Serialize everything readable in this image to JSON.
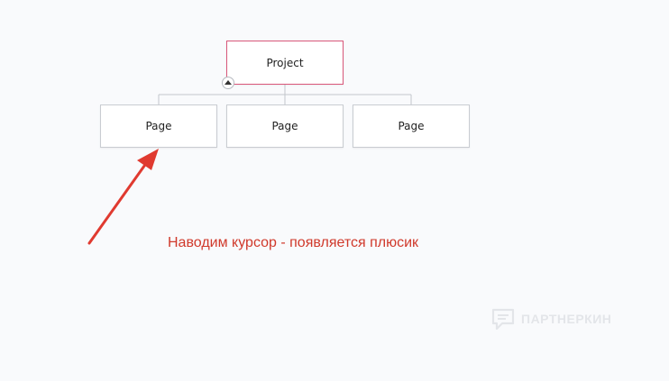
{
  "diagram": {
    "root": {
      "label": "Project"
    },
    "children": [
      {
        "label": "Page"
      },
      {
        "label": "Page"
      },
      {
        "label": "Page"
      }
    ]
  },
  "annotation": {
    "text": "Наводим курсор - появляется плюсик",
    "color": "#d0392b"
  },
  "watermark": {
    "text": "ПАРТНЕРКИН",
    "icon": "chat-bubble-icon"
  },
  "colors": {
    "root_border": "#d9577a",
    "node_border": "#c9ccd1",
    "connector": "#c3c7cc",
    "arrow": "#e03a30"
  }
}
